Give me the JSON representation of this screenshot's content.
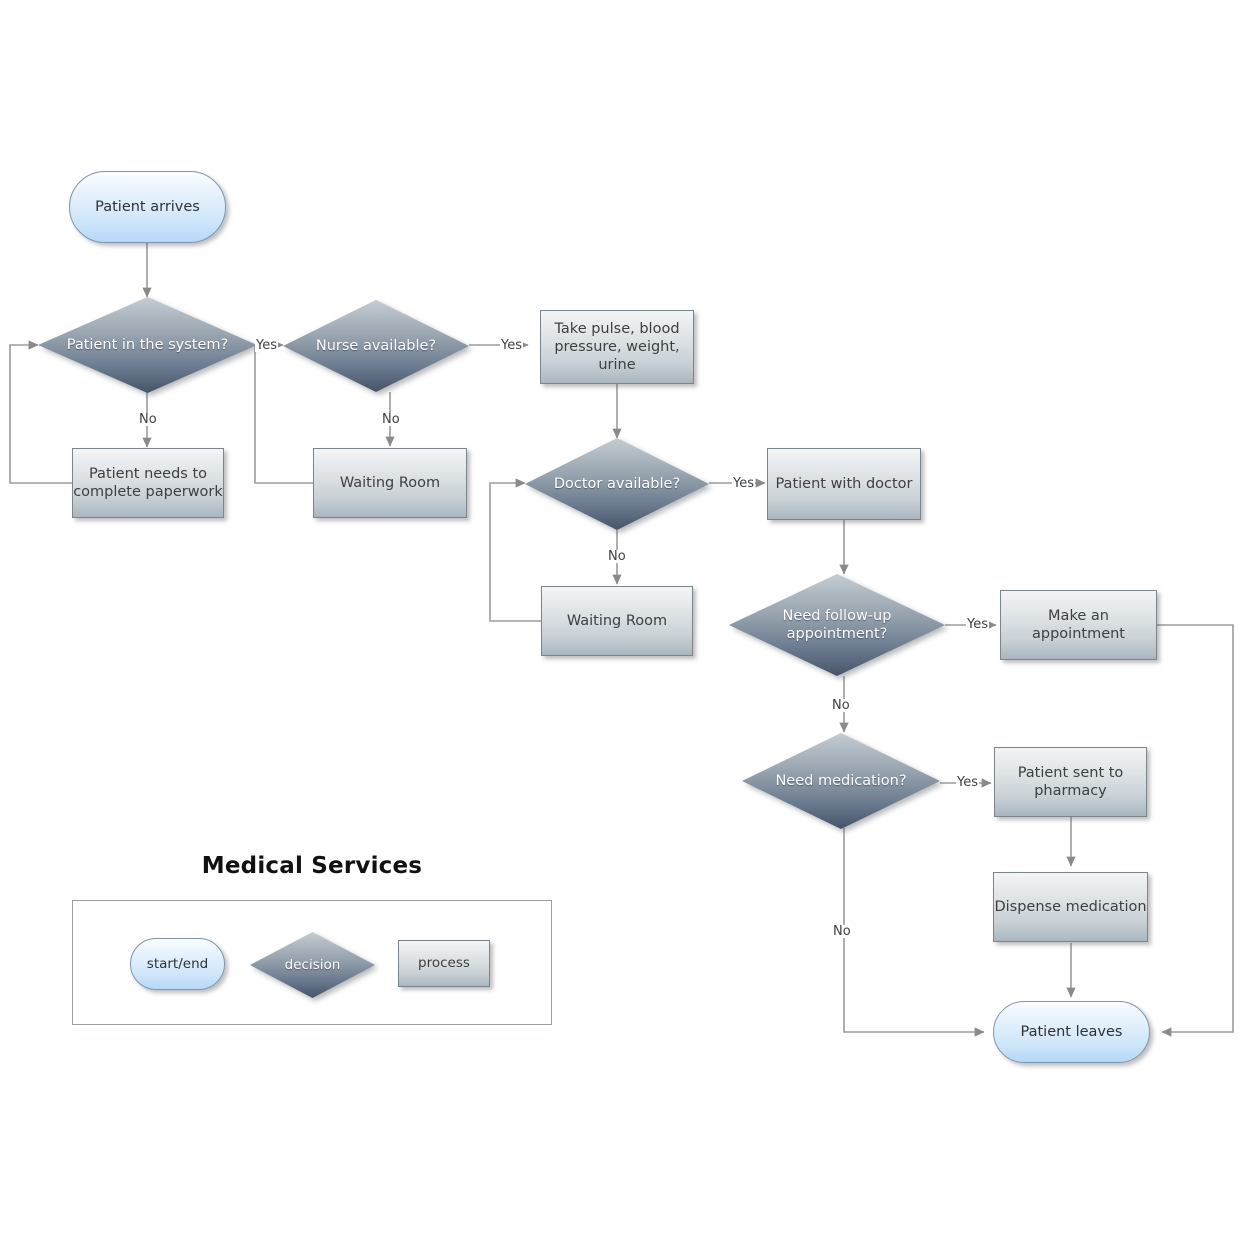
{
  "diagram": {
    "title": "Medical Services",
    "type": "flowchart"
  },
  "nodes": {
    "patient_arrives": {
      "label": "Patient arrives",
      "shape": "terminator"
    },
    "patient_in_system": {
      "label": "Patient in the system?",
      "shape": "decision"
    },
    "complete_paperwork": {
      "label": "Patient needs to complete paperwork",
      "shape": "process"
    },
    "nurse_available": {
      "label": "Nurse available?",
      "shape": "decision"
    },
    "waiting_room_nurse": {
      "label": "Waiting Room",
      "shape": "process"
    },
    "take_vitals": {
      "label": "Take pulse, blood pressure, weight, urine",
      "shape": "process"
    },
    "doctor_available": {
      "label": "Doctor available?",
      "shape": "decision"
    },
    "waiting_room_doctor": {
      "label": "Waiting Room",
      "shape": "process"
    },
    "patient_with_doctor": {
      "label": "Patient with doctor",
      "shape": "process"
    },
    "need_followup": {
      "label": "Need follow-up appointment?",
      "shape": "decision"
    },
    "make_appointment": {
      "label": "Make an appointment",
      "shape": "process"
    },
    "need_medication": {
      "label": "Need medication?",
      "shape": "decision"
    },
    "sent_to_pharmacy": {
      "label": "Patient sent to pharmacy",
      "shape": "process"
    },
    "dispense_medication": {
      "label": "Dispense medication",
      "shape": "process"
    },
    "patient_leaves": {
      "label": "Patient leaves",
      "shape": "terminator"
    }
  },
  "edge_labels": {
    "system_yes": "Yes",
    "system_no": "No",
    "nurse_yes": "Yes",
    "nurse_no": "No",
    "doctor_yes": "Yes",
    "doctor_no": "No",
    "followup_yes": "Yes",
    "followup_no": "No",
    "medication_yes": "Yes",
    "medication_no": "No"
  },
  "legend": {
    "title": "Medical Services",
    "items": [
      {
        "label": "start/end",
        "shape": "terminator"
      },
      {
        "label": "decision",
        "shape": "decision"
      },
      {
        "label": "process",
        "shape": "process"
      }
    ]
  },
  "colors": {
    "process_top": "#f3f5f6",
    "process_bottom": "#aab6bf",
    "terminator_top": "#fbfdff",
    "terminator_bottom": "#b6d8f7",
    "decision_top": "#c5ccd2",
    "decision_bottom": "#465469",
    "edge_line": "#9b9b9b",
    "text": "#3c4043",
    "decision_text": "#ffffff",
    "title_text": "#111111"
  },
  "chart_data": {
    "type": "diagram",
    "title": "Medical Services",
    "edges": [
      {
        "from": "patient_arrives",
        "to": "patient_in_system",
        "label": ""
      },
      {
        "from": "patient_in_system",
        "to": "nurse_available",
        "label": "Yes"
      },
      {
        "from": "patient_in_system",
        "to": "complete_paperwork",
        "label": "No"
      },
      {
        "from": "complete_paperwork",
        "to": "patient_in_system",
        "label": ""
      },
      {
        "from": "nurse_available",
        "to": "take_vitals",
        "label": "Yes"
      },
      {
        "from": "nurse_available",
        "to": "waiting_room_nurse",
        "label": "No"
      },
      {
        "from": "waiting_room_nurse",
        "to": "nurse_available",
        "label": ""
      },
      {
        "from": "take_vitals",
        "to": "doctor_available",
        "label": ""
      },
      {
        "from": "doctor_available",
        "to": "patient_with_doctor",
        "label": "Yes"
      },
      {
        "from": "doctor_available",
        "to": "waiting_room_doctor",
        "label": "No"
      },
      {
        "from": "waiting_room_doctor",
        "to": "doctor_available",
        "label": ""
      },
      {
        "from": "patient_with_doctor",
        "to": "need_followup",
        "label": ""
      },
      {
        "from": "need_followup",
        "to": "make_appointment",
        "label": "Yes"
      },
      {
        "from": "need_followup",
        "to": "need_medication",
        "label": "No"
      },
      {
        "from": "make_appointment",
        "to": "patient_leaves",
        "label": ""
      },
      {
        "from": "need_medication",
        "to": "sent_to_pharmacy",
        "label": "Yes"
      },
      {
        "from": "need_medication",
        "to": "patient_leaves",
        "label": "No"
      },
      {
        "from": "sent_to_pharmacy",
        "to": "dispense_medication",
        "label": ""
      },
      {
        "from": "dispense_medication",
        "to": "patient_leaves",
        "label": ""
      }
    ]
  }
}
